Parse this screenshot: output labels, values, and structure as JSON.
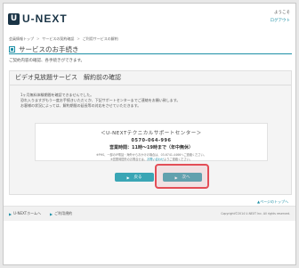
{
  "header": {
    "logo_mark": "U",
    "logo_text": "U-NEXT",
    "greeting": "ようこそ",
    "logout_label": "ログアウト"
  },
  "breadcrumb": [
    "会員情報トップ",
    "サービスの契約確認",
    "ご利用サービスの解約"
  ],
  "page": {
    "title": "サービスのお手続き",
    "subtitle": "ご契約内容の確認、各手続きができます。"
  },
  "section": {
    "heading": "ビデオ見放題サービス　解約前の確認",
    "body_lines": [
      "1ヶ月無料体験期間を確認できませんでした。",
      "恐れ入りますがもう一度お手続きいただくか、下記サポートセンターまでご連絡をお願い致します。",
      "お客様の状況によっては、解約期限の延長等の対応をさせていただきます。"
    ]
  },
  "support": {
    "title": "＜U-NEXTテクニカルサポートセンター＞",
    "phone": "0570-064-996",
    "hours": "営業時間：11時～19時まで（年中無休）",
    "note_1": "※PHS、一部のIP電話・海外からおかけの場合は、03-6741-4466へご連絡ください。",
    "note_2_prefix": "※営業時間外のお問合せは、",
    "note_2_link": "お問い合わせ",
    "note_2_suffix": "よりご連絡ください。"
  },
  "buttons": {
    "back_label": "戻る",
    "next_label": "次へ"
  },
  "page_top_label": "▲ページのトップへ",
  "footer": {
    "home_label": "U-NEXTホームへ",
    "terms_label": "ご利用規約",
    "copyright": "Copyright©2014 U-NEXT Inc. All rights reserved."
  },
  "colors": {
    "accent": "#1d8fa6",
    "button": "#3aa6b5",
    "highlight": "#e34e57",
    "logo": "#1a3446"
  }
}
